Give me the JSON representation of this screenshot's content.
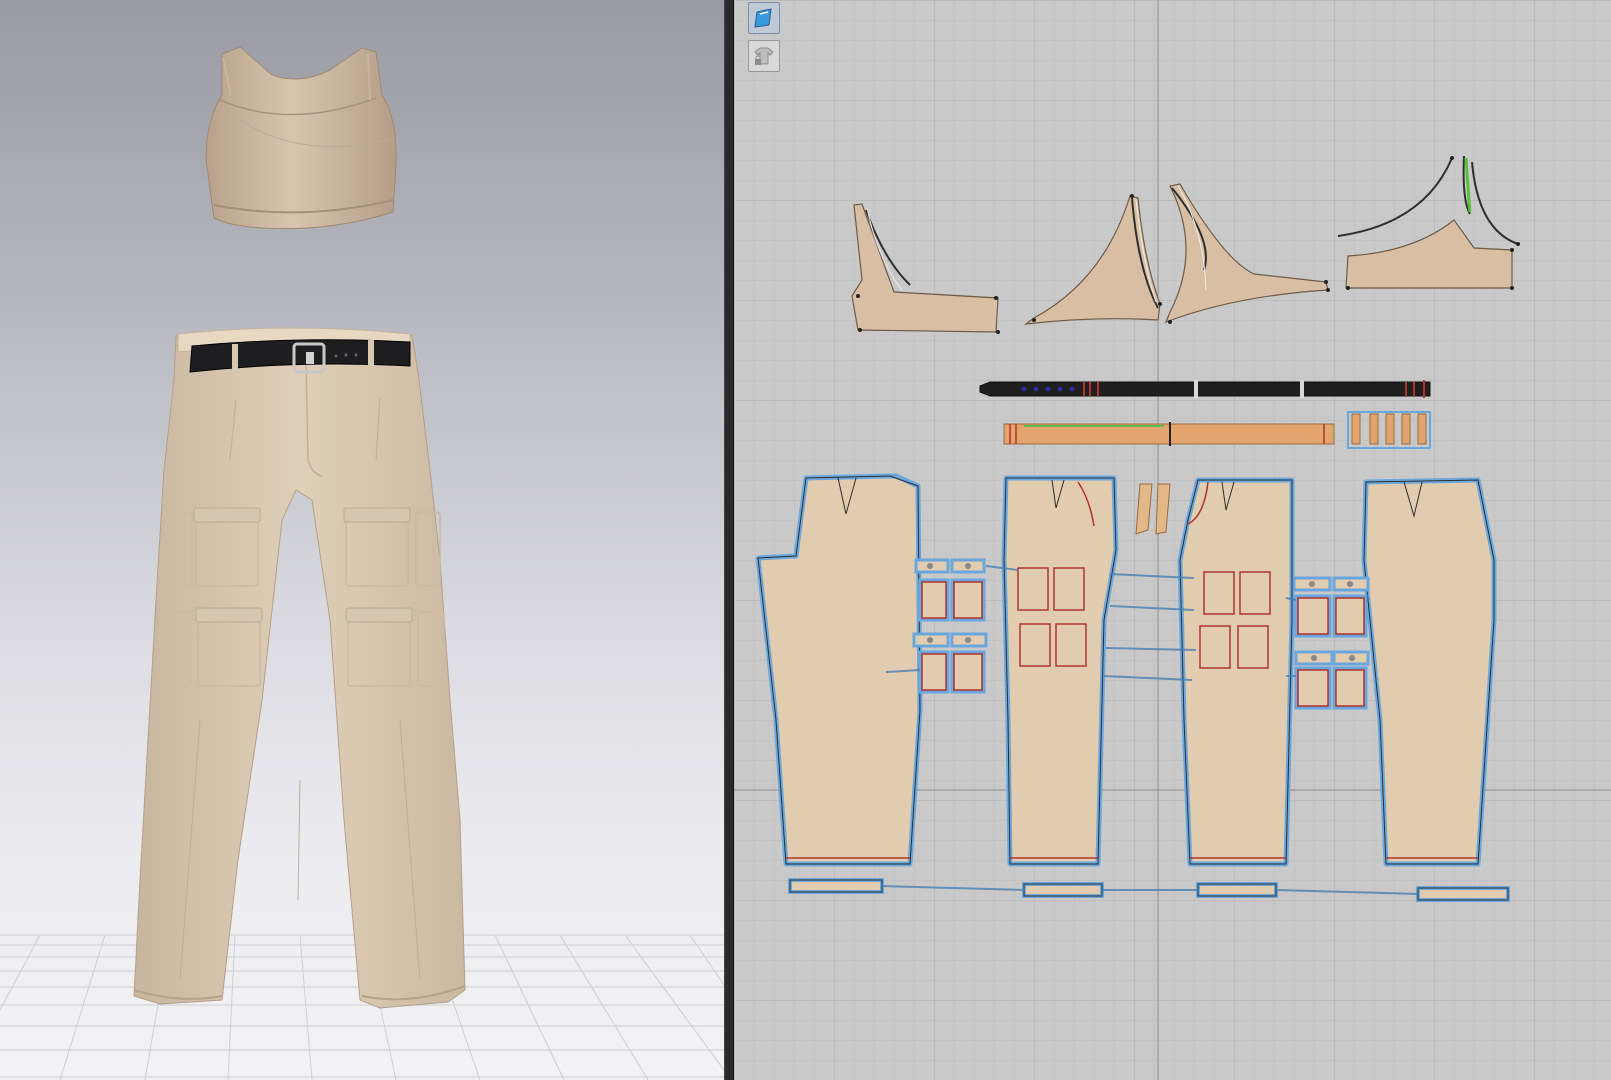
{
  "app": {
    "panels": [
      "3d-garment-window",
      "2d-pattern-window"
    ]
  },
  "viewport_3d": {
    "garments": [
      "crop-top",
      "cargo-pants",
      "belt"
    ],
    "background_gradient": [
      "#9a9aa2",
      "#f2f2f4"
    ],
    "floor_grid": true
  },
  "viewport_2d": {
    "toolbar": {
      "tools": [
        {
          "icon": "show-pattern-icon",
          "active": true
        },
        {
          "icon": "lock-garment-icon",
          "active": false
        }
      ]
    },
    "grid": true,
    "fabric_color": "#e0cbb0",
    "outline_color": "#6aa7dd",
    "stitch_color": "#b0342c",
    "piece_groups": [
      "top-pieces",
      "belt-pieces",
      "pants-pieces",
      "hem-cuffs",
      "pocket-pieces"
    ]
  }
}
